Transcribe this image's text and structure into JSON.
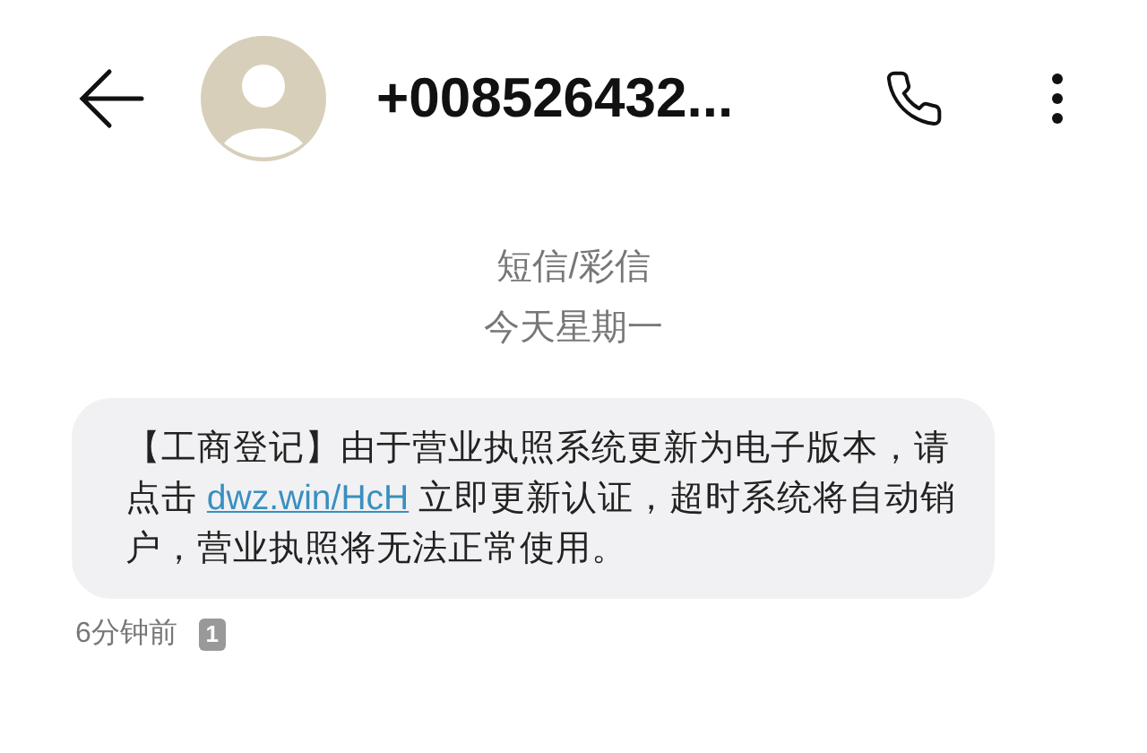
{
  "header": {
    "contact": "+008526432..."
  },
  "date_label": {
    "type": "短信/彩信",
    "day": "今天星期一"
  },
  "message": {
    "text_before": "【工商登记】由于营业执照系统更新为电子版本，请点击 ",
    "link": "dwz.win/HcH",
    "text_after": " 立即更新认证，超时系统将自动销户，营业执照将无法正常使用。",
    "time": "6分钟前",
    "sim": "1"
  }
}
